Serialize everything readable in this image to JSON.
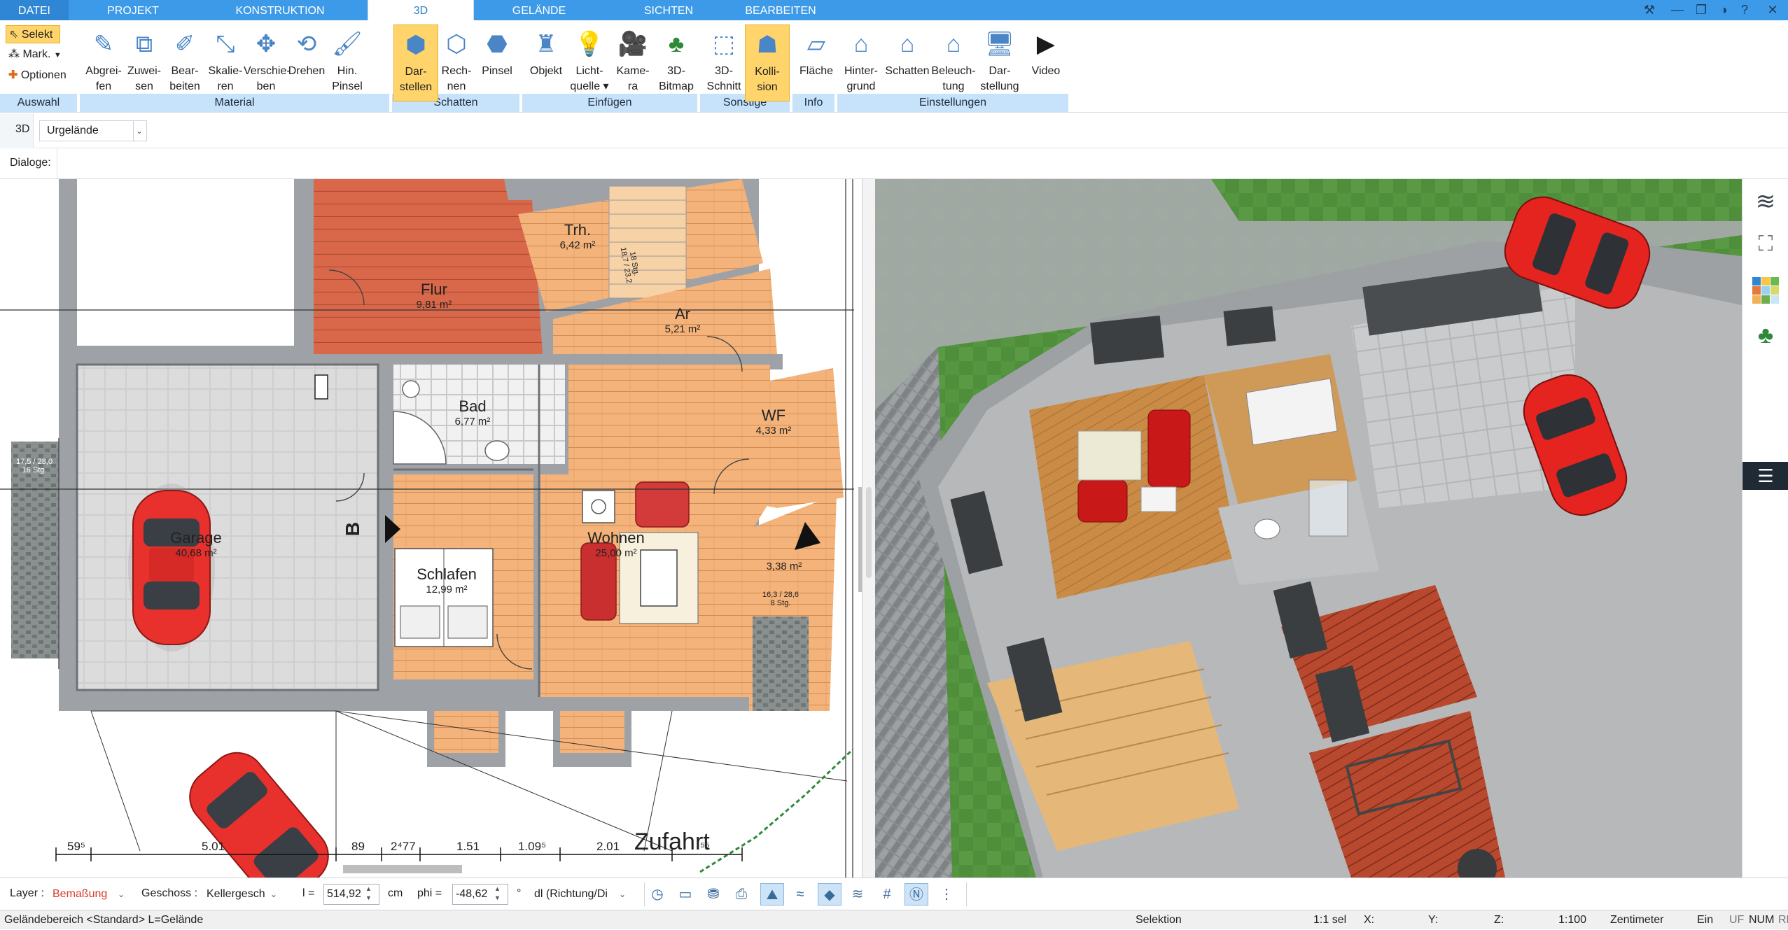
{
  "menu": {
    "tabs": [
      "DATEI",
      "PROJEKT",
      "KONSTRUKTION",
      "3D",
      "GELÄNDE",
      "SICHTEN",
      "BEARBEITEN"
    ],
    "active": "3D"
  },
  "window_controls": {
    "tools": "⚒",
    "minimize": "—",
    "restore": "❐",
    "close": "✕",
    "theme": "◑",
    "help": "?"
  },
  "ribbon": {
    "auswahl": {
      "select": "Selekt",
      "mark": "Mark.",
      "options": "Optionen",
      "group": "Auswahl"
    },
    "material": {
      "buttons": [
        "Abgrei-\nfen",
        "Zuwei-\nsen",
        "Bear-\nbeiten",
        "Skalie-\nren",
        "Verschie-\nben",
        "Drehen",
        "Hin.\nPinsel"
      ],
      "group": "Material"
    },
    "schatten": {
      "buttons": [
        "Dar-\nstellen",
        "Rech-\nnen",
        "Pinsel"
      ],
      "group": "Schatten"
    },
    "einfuegen": {
      "buttons": [
        "Objekt",
        "Licht-\nquelle ▾",
        "Kame-\nra",
        "3D-\nBitmap"
      ],
      "group": "Einfügen"
    },
    "sonstige": {
      "buttons": [
        "3D-\nSchnitt",
        "Kolli-\nsion"
      ],
      "group": "Sonstige"
    },
    "info": {
      "buttons": [
        "Fläche"
      ],
      "group": "Info"
    },
    "einstellungen": {
      "buttons": [
        "Hinter-\ngrund",
        "Schatten",
        "Beleuch-\ntung",
        "Dar-\nstellung",
        "Video"
      ],
      "group": "Einstellungen"
    }
  },
  "toolbar": {
    "mode": "3D",
    "terrain_select": "Urgelände",
    "dialog_label": "Dialoge:"
  },
  "plan": {
    "rooms": [
      {
        "name": "Flur",
        "area": "9,81 m²"
      },
      {
        "name": "Trh.",
        "area": "6,42 m²"
      },
      {
        "name": "Ar",
        "area": "5,21 m²"
      },
      {
        "name": "Bad",
        "area": "6,77 m²"
      },
      {
        "name": "WF",
        "area": "4,33 m²"
      },
      {
        "name": "Garage",
        "area": "40,68 m²"
      },
      {
        "name": "Wohnen",
        "area": "25,00 m²"
      },
      {
        "name": "Schlafen",
        "area": "12,99 m²"
      },
      {
        "name": "",
        "area": "3,38 m²"
      }
    ],
    "stair_notes": [
      "17,5 / 28,0\n16 Stg.",
      "16,3 / 28,6\n8 Stg.",
      "18 Stg.\n18,7 / 23,2"
    ],
    "section_marker": "B",
    "dimensions": [
      "59⁵",
      "5.01",
      "89",
      "2⁴77",
      "1.51",
      "1.09⁵",
      "2.01",
      "⁵⁵"
    ],
    "driveway_label": "Zufahrt"
  },
  "side_panel_icons": [
    "layers-icon",
    "furniture-icon",
    "materials-icon",
    "plant-icon",
    "menu-icon"
  ],
  "bottom": {
    "layer_label": "Layer :",
    "layer_value": "Bemaßung",
    "floor_label": "Geschoss :",
    "floor_value": "Kellergesch",
    "l_label": "l =",
    "l_value": "514,92",
    "l_unit": "cm",
    "phi_label": "phi =",
    "phi_value": "-48,62",
    "phi_unit": "°",
    "dl_value": "dl (Richtung/Di",
    "colors": {
      "layer_value": "#d83a2a"
    }
  },
  "status": {
    "left": "Geländebereich <Standard> L=Gelände",
    "mode": "Selektion",
    "sel": "1:1 sel",
    "x": "X:",
    "y": "Y:",
    "z": "Z:",
    "scale": "1:100",
    "unit": "Zentimeter",
    "ein": "Ein",
    "uf": "UF",
    "num": "NUM",
    "rf": "RF"
  }
}
